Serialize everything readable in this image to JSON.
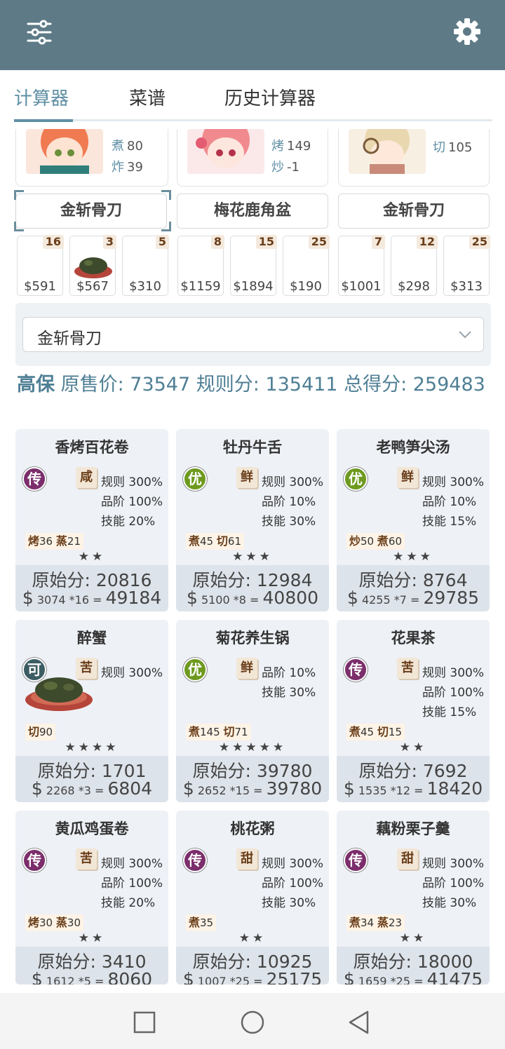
{
  "header": {
    "menu_icon": "sliders-icon",
    "settings_icon": "gear-icon"
  },
  "tabs": [
    {
      "label": "计算器",
      "active": true
    },
    {
      "label": "菜谱"
    },
    {
      "label": "历史计算器"
    }
  ],
  "chefs": [
    {
      "skills": [
        {
          "name": "煮",
          "value": "80"
        },
        {
          "name": "炸",
          "value": "39"
        }
      ]
    },
    {
      "skills": [
        {
          "name": "烤",
          "value": "149"
        },
        {
          "name": "炒",
          "value": "-1"
        }
      ]
    },
    {
      "skills": [
        {
          "name": "切",
          "value": "105"
        }
      ]
    }
  ],
  "knives": [
    {
      "label": "金斩骨刀"
    },
    {
      "label": "梅花鹿角盆"
    },
    {
      "label": "金斩骨刀"
    }
  ],
  "slots": [
    {
      "qty": "16",
      "price": "$591"
    },
    {
      "qty": "3",
      "price": "$567"
    },
    {
      "qty": "5",
      "price": "$310"
    },
    {
      "qty": "8",
      "price": "$1159"
    },
    {
      "qty": "15",
      "price": "$1894"
    },
    {
      "qty": "25",
      "price": "$190"
    },
    {
      "qty": "7",
      "price": "$1001"
    },
    {
      "qty": "12",
      "price": "$298"
    },
    {
      "qty": "25",
      "price": "$313"
    }
  ],
  "select": {
    "value": "金斩骨刀"
  },
  "summary": {
    "grade": "高保",
    "text": " 原售价: 73547 规则分: 135411 总得分: 259483"
  },
  "colors": {
    "legend": "#7b2e6b",
    "excellent": "#6d9a1e",
    "ok": "#3c5d64",
    "accent": "#5f8fa4"
  },
  "dishes": [
    {
      "name": "香烤百花卷",
      "rarity": "传",
      "rarity_color": "#7b2e6b",
      "taste": "咸",
      "mods": [
        "规则 300%",
        "品阶 100%",
        "技能 20%"
      ],
      "skills": [
        [
          "烤",
          "36"
        ],
        [
          "蒸",
          "21"
        ]
      ],
      "stars": "★★",
      "raw": "原始分: 20816",
      "price": "3074",
      "mult": "*16",
      "total": "49184"
    },
    {
      "name": "牡丹牛舌",
      "rarity": "优",
      "rarity_color": "#6d9a1e",
      "taste": "鲜",
      "mods": [
        "规则 300%",
        "品阶 10%",
        "技能 30%"
      ],
      "skills": [
        [
          "煮",
          "45"
        ],
        [
          "切",
          "61"
        ]
      ],
      "stars": "★★★",
      "raw": "原始分: 12984",
      "price": "5100",
      "mult": "*8",
      "total": "40800"
    },
    {
      "name": "老鸭笋尖汤",
      "rarity": "优",
      "rarity_color": "#6d9a1e",
      "taste": "鲜",
      "mods": [
        "规则 300%",
        "品阶 10%",
        "技能 15%"
      ],
      "skills": [
        [
          "炒",
          "50"
        ],
        [
          "煮",
          "60"
        ]
      ],
      "stars": "★★★",
      "raw": "原始分: 8764",
      "price": "4255",
      "mult": "*7",
      "total": "29785"
    },
    {
      "name": "醉蟹",
      "rarity": "可",
      "rarity_color": "#3c5d64",
      "taste": "苦",
      "mods": [
        "规则 300%"
      ],
      "skills": [
        [
          "切",
          "90"
        ]
      ],
      "stars": "★★★★",
      "raw": "原始分: 1701",
      "price": "2268",
      "mult": "*3",
      "total": "6804"
    },
    {
      "name": "菊花养生锅",
      "rarity": "优",
      "rarity_color": "#6d9a1e",
      "taste": "鲜",
      "mods": [
        "品阶 10%",
        "技能 30%"
      ],
      "skills": [
        [
          "煮",
          "145"
        ],
        [
          "切",
          "71"
        ]
      ],
      "stars": "★★★★★",
      "raw": "原始分: 39780",
      "price": "2652",
      "mult": "*15",
      "total": "39780"
    },
    {
      "name": "花果茶",
      "rarity": "传",
      "rarity_color": "#7b2e6b",
      "taste": "苦",
      "mods": [
        "规则 300%",
        "品阶 100%",
        "技能 15%"
      ],
      "skills": [
        [
          "煮",
          "45"
        ],
        [
          "切",
          "15"
        ]
      ],
      "stars": "★★",
      "raw": "原始分: 7692",
      "price": "1535",
      "mult": "*12",
      "total": "18420"
    },
    {
      "name": "黄瓜鸡蛋卷",
      "rarity": "传",
      "rarity_color": "#7b2e6b",
      "taste": "苦",
      "mods": [
        "规则 300%",
        "品阶 100%",
        "技能 20%"
      ],
      "skills": [
        [
          "烤",
          "30"
        ],
        [
          "蒸",
          "30"
        ]
      ],
      "stars": "★★",
      "raw": "原始分: 3410",
      "price": "1612",
      "mult": "*5",
      "total": "8060"
    },
    {
      "name": "桃花粥",
      "rarity": "传",
      "rarity_color": "#7b2e6b",
      "taste": "甜",
      "mods": [
        "规则 300%",
        "品阶 100%",
        "技能 30%"
      ],
      "skills": [
        [
          "煮",
          "35"
        ]
      ],
      "stars": "★★",
      "raw": "原始分: 10925",
      "price": "1007",
      "mult": "*25",
      "total": "25175"
    },
    {
      "name": "藕粉栗子羹",
      "rarity": "传",
      "rarity_color": "#7b2e6b",
      "taste": "甜",
      "mods": [
        "规则 300%",
        "品阶 100%",
        "技能 30%"
      ],
      "skills": [
        [
          "煮",
          "34"
        ],
        [
          "蒸",
          "23"
        ]
      ],
      "stars": "★★",
      "raw": "原始分: 18000",
      "price": "1659",
      "mult": "*25",
      "total": "41475"
    }
  ],
  "nav": {
    "recent_icon": "square-icon",
    "home_icon": "circle-icon",
    "back_icon": "triangle-back-icon"
  }
}
